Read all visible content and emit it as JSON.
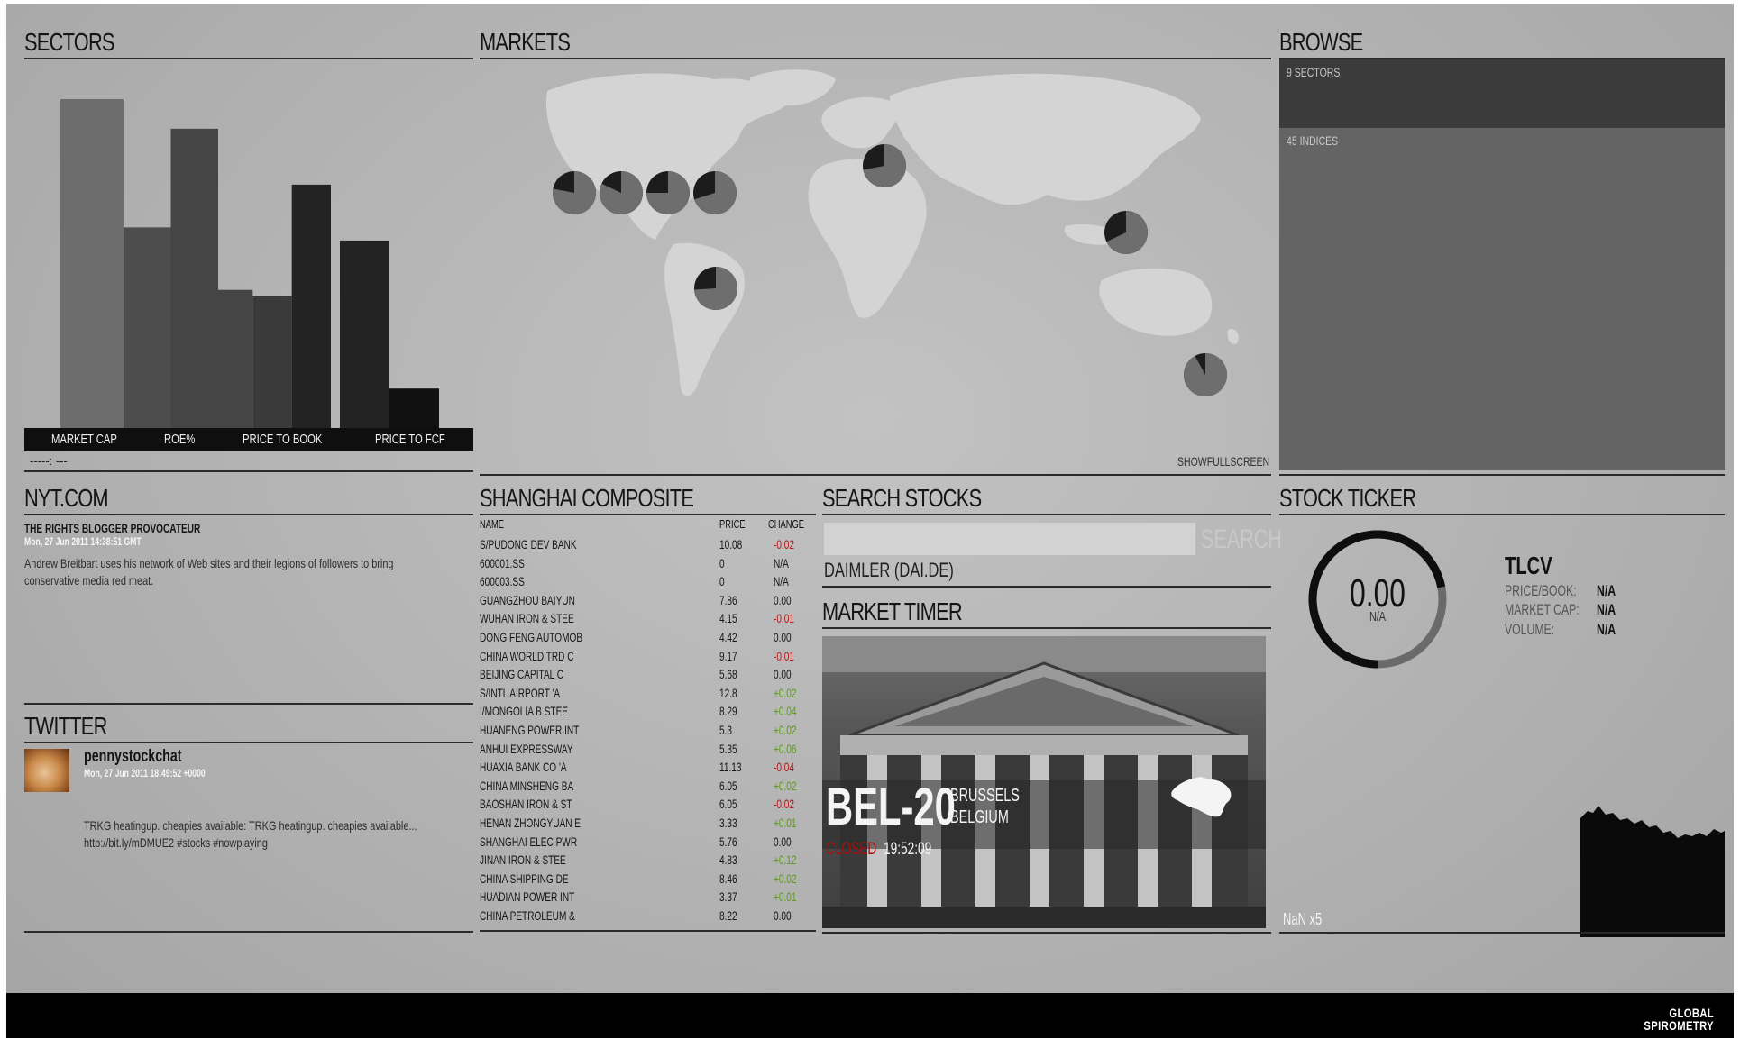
{
  "headers": {
    "sectors": "SECTORS",
    "markets": "MARKETS",
    "browse": "BROWSE",
    "nyt": "NYT.COM",
    "twitter": "TWITTER",
    "shanghai": "SHANGHAI COMPOSITE",
    "search": "SEARCH STOCKS",
    "timer": "MARKET TIMER",
    "ticker": "STOCK TICKER"
  },
  "sectors": {
    "axis_labels": [
      "MARKET CAP",
      "ROE%",
      "PRICE TO BOOK",
      "PRICE TO FCF"
    ],
    "footer_text": "-----:  ---"
  },
  "chart_data": {
    "type": "bar",
    "title": "",
    "categories": [
      "MARKET CAP",
      "ROE%",
      "PRICE TO BOOK",
      "PRICE TO FCF"
    ],
    "series": [
      {
        "values": [
          1.0,
          0.0,
          0.0,
          0.0
        ]
      },
      {
        "values": [
          0.0,
          0.61,
          0.0,
          0.0
        ]
      },
      {
        "values": [
          0.0,
          0.91,
          0.42,
          0.0
        ]
      },
      {
        "values": [
          0.0,
          0.0,
          0.4,
          0.0
        ]
      },
      {
        "values": [
          0.0,
          0.0,
          0.74,
          0.57
        ]
      },
      {
        "values": [
          0.0,
          0.0,
          0.0,
          0.12
        ]
      }
    ],
    "series_colors": [
      "#6d6d6d",
      "#4d4d4d",
      "#454545",
      "#3a3a3a",
      "#232323",
      "#111111"
    ],
    "ylim": [
      0,
      1
    ]
  },
  "markets": {
    "showfullscreen": "SHOWFULLSCREEN",
    "pies": [
      {
        "fraction": 0.78
      },
      {
        "fraction": 0.82
      },
      {
        "fraction": 0.75
      },
      {
        "fraction": 0.7
      },
      {
        "fraction": 0.72
      },
      {
        "fraction": 0.68
      },
      {
        "fraction": 0.74
      },
      {
        "fraction": 0.92
      }
    ]
  },
  "browse": {
    "sectors_label": "9 SECTORS",
    "indices_label": "45 INDICES"
  },
  "nyt": {
    "headline": "THE RIGHTS BLOGGER PROVOCATEUR",
    "date": "Mon, 27 Jun 2011 14:38:51 GMT",
    "body": "Andrew Breitbart uses his network of Web sites and their legions of followers to bring conservative media red meat."
  },
  "twitter": {
    "user": "pennystockchat",
    "date": "Mon, 27 Jun 2011 18:49:52 +0000",
    "body": "TRKG heatingup. cheapies available: TRKG heatingup. cheapies available... http://bit.ly/mDMUE2 #stocks #nowplaying"
  },
  "shanghai": {
    "columns": [
      "NAME",
      "PRICE",
      "CHANGE"
    ],
    "rows": [
      {
        "name": "S/PUDONG DEV BANK",
        "price": "10.08",
        "change": "-0.02",
        "dir": "neg"
      },
      {
        "name": "600001.SS",
        "price": "0",
        "change": "N/A",
        "dir": "neu"
      },
      {
        "name": "600003.SS",
        "price": "0",
        "change": "N/A",
        "dir": "neu"
      },
      {
        "name": "GUANGZHOU BAIYUN",
        "price": "7.86",
        "change": "0.00",
        "dir": "neu"
      },
      {
        "name": "WUHAN IRON & STEE",
        "price": "4.15",
        "change": "-0.01",
        "dir": "neg"
      },
      {
        "name": "DONG FENG AUTOMOB",
        "price": "4.42",
        "change": "0.00",
        "dir": "neu"
      },
      {
        "name": "CHINA WORLD TRD C",
        "price": "9.17",
        "change": "-0.01",
        "dir": "neg"
      },
      {
        "name": "BEIJING CAPITAL C",
        "price": "5.68",
        "change": "0.00",
        "dir": "neu"
      },
      {
        "name": "S/INTL AIRPORT 'A",
        "price": "12.8",
        "change": "+0.02",
        "dir": "pos"
      },
      {
        "name": "I/MONGOLIA B STEE",
        "price": "8.29",
        "change": "+0.04",
        "dir": "pos"
      },
      {
        "name": "HUANENG POWER INT",
        "price": "5.3",
        "change": "+0.02",
        "dir": "pos"
      },
      {
        "name": "ANHUI EXPRESSWAY",
        "price": "5.35",
        "change": "+0.06",
        "dir": "pos"
      },
      {
        "name": "HUAXIA BANK CO 'A",
        "price": "11.13",
        "change": "-0.04",
        "dir": "neg"
      },
      {
        "name": "CHINA MINSHENG BA",
        "price": "6.05",
        "change": "+0.02",
        "dir": "pos"
      },
      {
        "name": "BAOSHAN IRON & ST",
        "price": "6.05",
        "change": "-0.02",
        "dir": "neg"
      },
      {
        "name": "HENAN ZHONGYUAN E",
        "price": "3.33",
        "change": "+0.01",
        "dir": "pos"
      },
      {
        "name": "SHANGHAI ELEC PWR",
        "price": "5.76",
        "change": "0.00",
        "dir": "neu"
      },
      {
        "name": "JINAN IRON & STEE",
        "price": "4.83",
        "change": "+0.12",
        "dir": "pos"
      },
      {
        "name": "CHINA SHIPPING DE",
        "price": "8.46",
        "change": "+0.02",
        "dir": "pos"
      },
      {
        "name": "HUADIAN POWER INT",
        "price": "3.37",
        "change": "+0.01",
        "dir": "pos"
      },
      {
        "name": "CHINA PETROLEUM &",
        "price": "8.22",
        "change": "0.00",
        "dir": "neu"
      }
    ]
  },
  "search": {
    "placeholder": "",
    "button": "SEARCH",
    "result": "DAIMLER     (DAI.DE)"
  },
  "timer": {
    "index": "BEL-20",
    "city": "BRUSSELS",
    "country": "BELGIUM",
    "status": "CLOSED",
    "time": "19:52:09"
  },
  "ticker": {
    "value": "0.00",
    "value_sub": "N/A",
    "gauge_fraction": 0.72,
    "symbol": "TLCV",
    "stats": [
      {
        "label": "PRICE/BOOK:",
        "value": "N/A"
      },
      {
        "label": "MARKET CAP:",
        "value": "N/A"
      },
      {
        "label": "VOLUME:",
        "value": "N/A"
      }
    ],
    "footer": "NaN  x5"
  },
  "footer": {
    "logo_line1": "GLOBAL",
    "logo_line2": "SPIROMETRY"
  },
  "colors": {
    "background": "#b4b4b4",
    "positive": "#5e9a1e",
    "negative": "#b01818",
    "footer_bar": "#000000"
  }
}
